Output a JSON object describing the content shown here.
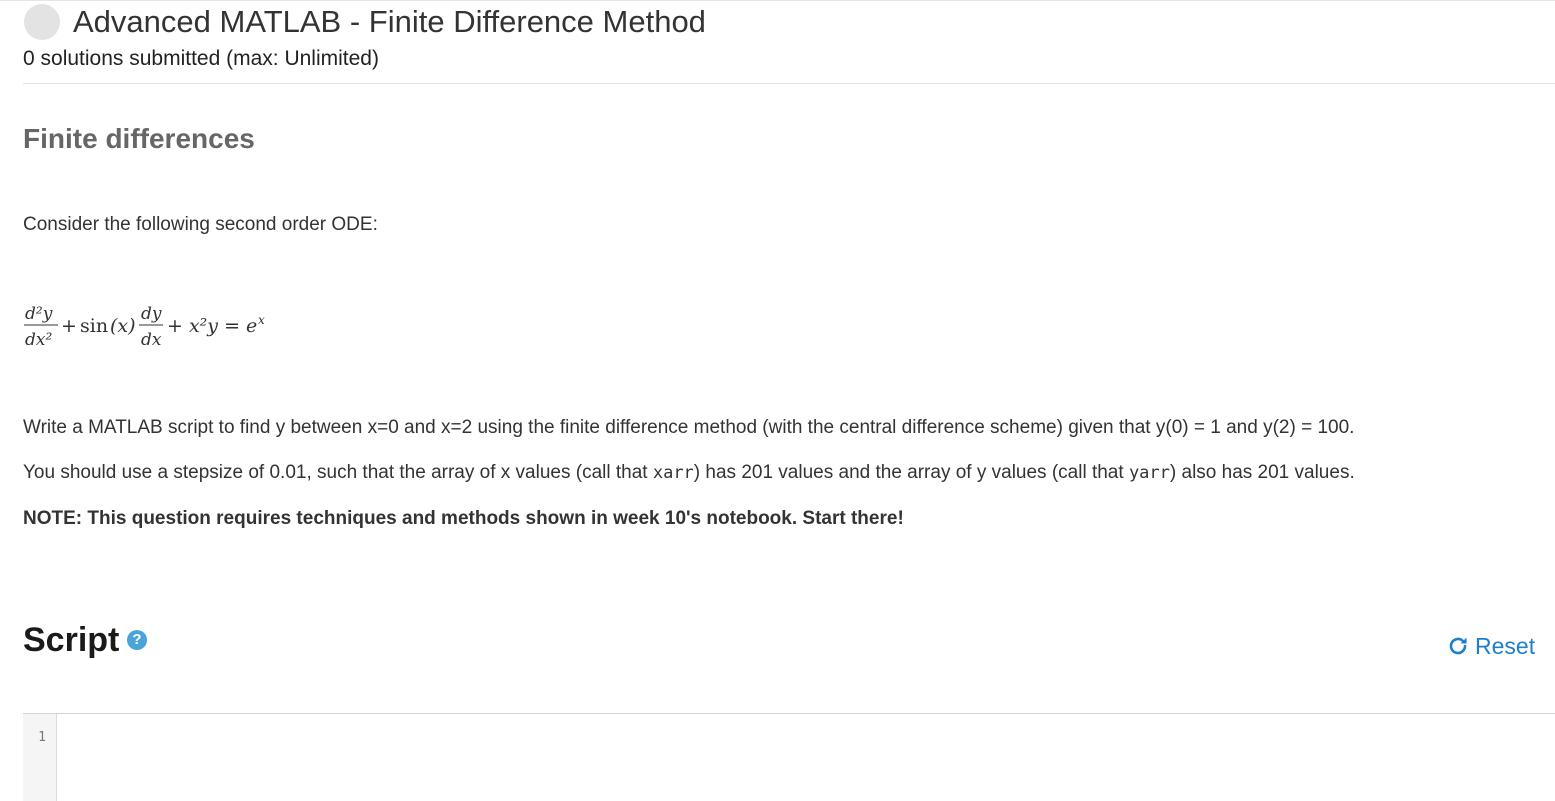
{
  "header": {
    "title": "Advanced MATLAB - Finite Difference Method",
    "submissions": "0 solutions submitted (max: Unlimited)"
  },
  "problem": {
    "heading": "Finite differences",
    "intro": "Consider the following second order ODE:",
    "equation": {
      "term1_num": "d²y",
      "term1_den": "dx²",
      "plus1": "+",
      "sin": "sin",
      "sin_arg": "(x)",
      "term2_num": "dy",
      "term2_den": "dx",
      "rest": "+ x²y = e",
      "exp": "x"
    },
    "para1": "Write a MATLAB script to find y between x=0 and x=2 using the finite difference method (with the central difference scheme) given that y(0) = 1 and y(2) = 100.",
    "para2_a": "You should use a stepsize of 0.01, such that the array of x values (call that ",
    "para2_code1": "xarr",
    "para2_b": ") has 201 values and the array of y values (call that ",
    "para2_code2": "yarr",
    "para2_c": ") also has 201 values.",
    "note": "NOTE: This question requires techniques and methods shown in week 10's notebook. Start there!"
  },
  "script": {
    "heading": "Script",
    "help_icon": "question-circle-icon",
    "reset_label": "Reset",
    "reset_icon": "refresh-icon",
    "line_numbers": [
      "1"
    ]
  },
  "colors": {
    "accent": "#1f7fc9",
    "help": "#4aa3d9",
    "heading_gray": "#666666"
  }
}
